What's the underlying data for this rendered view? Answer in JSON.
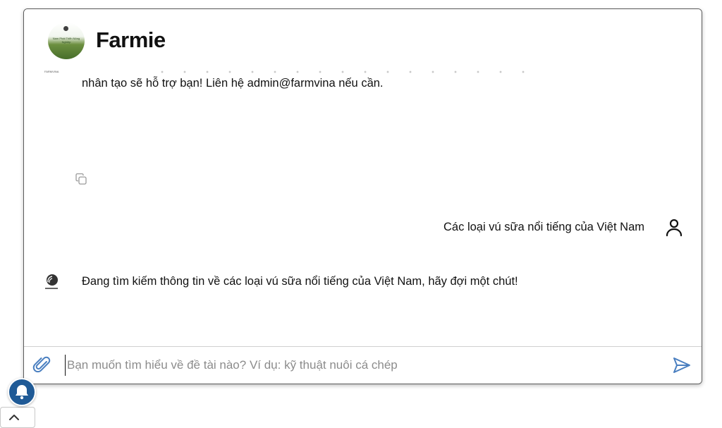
{
  "header": {
    "app_title": "Farmie",
    "logo_text": "Nam Phát Triển Nông Nghiệp"
  },
  "messages": {
    "bot_top_avatar_caption": "FARMVINA",
    "bot_message_1": "nhân tạo sẽ hỗ trợ bạn! Liên hệ admin@farmvina nếu cần.",
    "user_message": "Các loại vú sữa nổi tiếng của Việt Nam",
    "bot_avatar_caption": "FARMVINA",
    "bot_message_2": "Đang tìm kiếm thông tin về các loại vú sữa nổi tiếng của Việt Nam, hãy đợi một chút!"
  },
  "input": {
    "placeholder": "Bạn muốn tìm hiểu về đề tài nào? Ví dụ: kỹ thuật nuôi cá chép",
    "value": ""
  },
  "icons": {
    "copy": "copy-icon",
    "user": "user-icon",
    "attach": "paperclip-icon",
    "send": "send-icon",
    "bell": "bell-icon",
    "scroll_up": "chevron-up-icon",
    "loading": "loading-spinner-icon"
  },
  "colors": {
    "accent": "#1f5a96",
    "send_icon": "#4a7fc0",
    "attach_icon": "#4a7fc0"
  }
}
